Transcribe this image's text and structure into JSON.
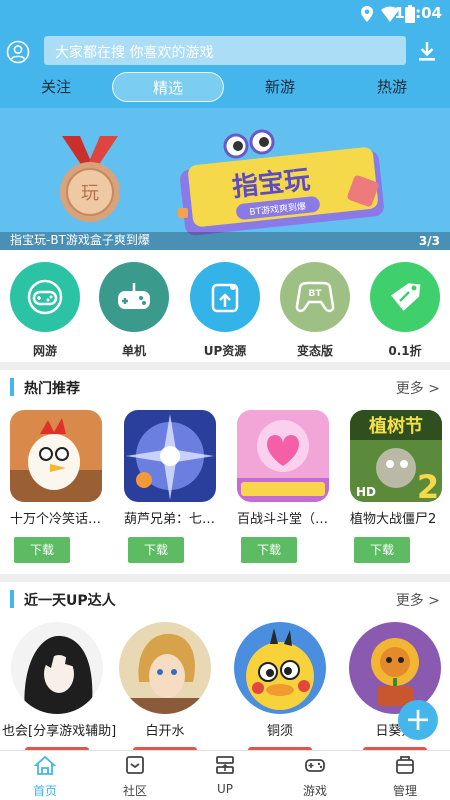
{
  "status_bar": {
    "time": "10:04"
  },
  "search": {
    "placeholder": "大家都在搜 你喜欢的游戏"
  },
  "tabs": [
    {
      "label": "关注"
    },
    {
      "label": "精选"
    },
    {
      "label": "新游"
    },
    {
      "label": "热游"
    }
  ],
  "banner": {
    "title": "指宝玩-BT游戏盒子爽到爆",
    "page": "3/3",
    "medal_text": "玩",
    "logo_text": "指宝玩",
    "logo_sub": "BT游戏爽到爆"
  },
  "categories": [
    {
      "label": "网游",
      "icon": "gamepad-icon",
      "color": "#2cc2a4"
    },
    {
      "label": "单机",
      "icon": "joystick-icon",
      "color": "#3a9a8c"
    },
    {
      "label": "UP资源",
      "icon": "share-icon",
      "color": "#34b3e8"
    },
    {
      "label": "变态版",
      "icon": "bt-gamepad-icon",
      "color": "#9fc084"
    },
    {
      "label": "0.1折",
      "icon": "discount-tag-icon",
      "color": "#3fcf6c"
    }
  ],
  "hot": {
    "title": "热门推荐",
    "more": "更多 >",
    "games": [
      {
        "name": "十万个冷笑话…",
        "button": "下载"
      },
      {
        "name": "葫芦兄弟：七…",
        "button": "下载"
      },
      {
        "name": "百战斗斗堂（…",
        "button": "下载"
      },
      {
        "name": "植物大战僵尸2",
        "button": "下载"
      }
    ]
  },
  "up": {
    "title": "近一天UP达人",
    "more": "更多 >",
    "users": [
      {
        "name": "也会[分享游戏辅助]"
      },
      {
        "name": "白开水"
      },
      {
        "name": "铜须"
      },
      {
        "name": "日葵姐"
      }
    ]
  },
  "game_icon_text": {
    "pvz": "植树节",
    "hd": "HD",
    "two": "2"
  },
  "fab": "+",
  "bottom_nav": [
    {
      "label": "首页"
    },
    {
      "label": "社区"
    },
    {
      "label": "UP"
    },
    {
      "label": "游戏"
    },
    {
      "label": "管理"
    }
  ]
}
